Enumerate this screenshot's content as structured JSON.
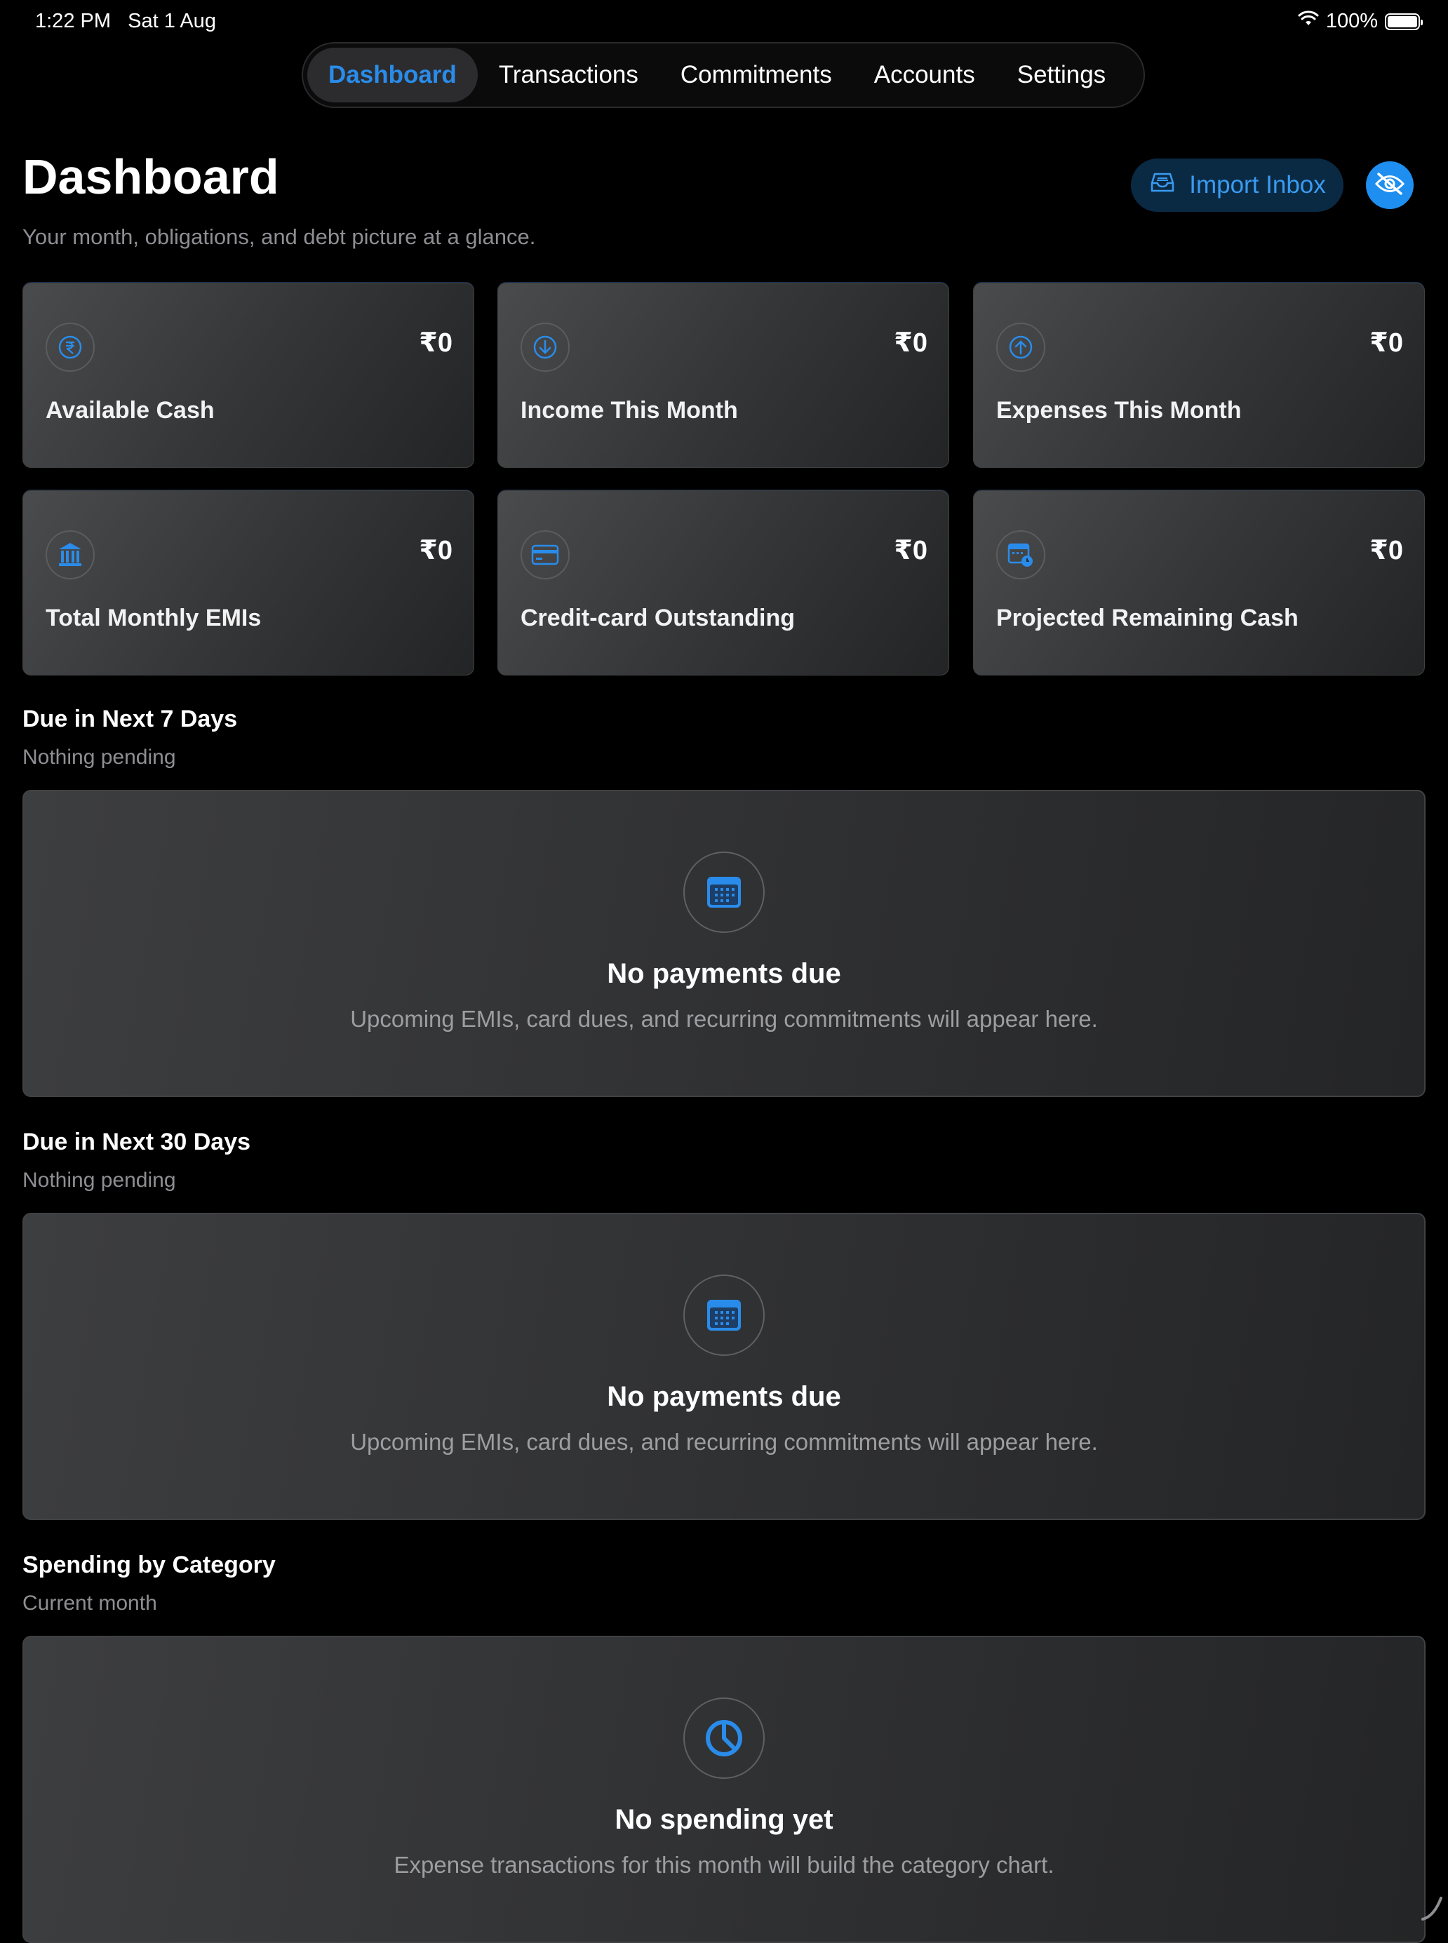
{
  "status_bar": {
    "time": "1:22 PM",
    "date": "Sat 1 Aug",
    "battery": "100%",
    "battery_level": 1.0,
    "wifi_icon": "wifi-icon"
  },
  "nav": {
    "tabs": [
      {
        "label": "Dashboard",
        "active": true
      },
      {
        "label": "Transactions",
        "active": false
      },
      {
        "label": "Commitments",
        "active": false
      },
      {
        "label": "Accounts",
        "active": false
      },
      {
        "label": "Settings",
        "active": false
      }
    ]
  },
  "header": {
    "title": "Dashboard",
    "subtitle": "Your month, obligations, and debt picture at a glance.",
    "import_label": "Import Inbox",
    "import_icon": "inbox-tray-icon",
    "privacy_icon": "eye-slash-icon"
  },
  "stats": [
    {
      "label": "Available Cash",
      "value": "₹0",
      "icon": "rupee-icon"
    },
    {
      "label": "Income This Month",
      "value": "₹0",
      "icon": "arrow-down-circle-icon"
    },
    {
      "label": "Expenses This Month",
      "value": "₹0",
      "icon": "arrow-up-circle-icon"
    },
    {
      "label": "Total Monthly EMIs",
      "value": "₹0",
      "icon": "bank-icon"
    },
    {
      "label": "Credit-card Outstanding",
      "value": "₹0",
      "icon": "credit-card-icon"
    },
    {
      "label": "Projected Remaining Cash",
      "value": "₹0",
      "icon": "calendar-clock-icon"
    }
  ],
  "sections": [
    {
      "title": "Due in Next 7 Days",
      "subtitle": "Nothing pending",
      "empty_title": "No payments due",
      "empty_body": "Upcoming EMIs, card dues, and recurring commitments will appear here.",
      "icon": "calendar-icon"
    },
    {
      "title": "Due in Next 30 Days",
      "subtitle": "Nothing pending",
      "empty_title": "No payments due",
      "empty_body": "Upcoming EMIs, card dues, and recurring commitments will appear here.",
      "icon": "calendar-icon"
    },
    {
      "title": "Spending by Category",
      "subtitle": "Current month",
      "empty_title": "No spending yet",
      "empty_body": "Expense transactions for this month will build the category chart.",
      "icon": "pie-chart-icon"
    }
  ],
  "colors": {
    "accent": "#2a8cea",
    "background": "#000000",
    "muted_text": "#8e8e93"
  }
}
